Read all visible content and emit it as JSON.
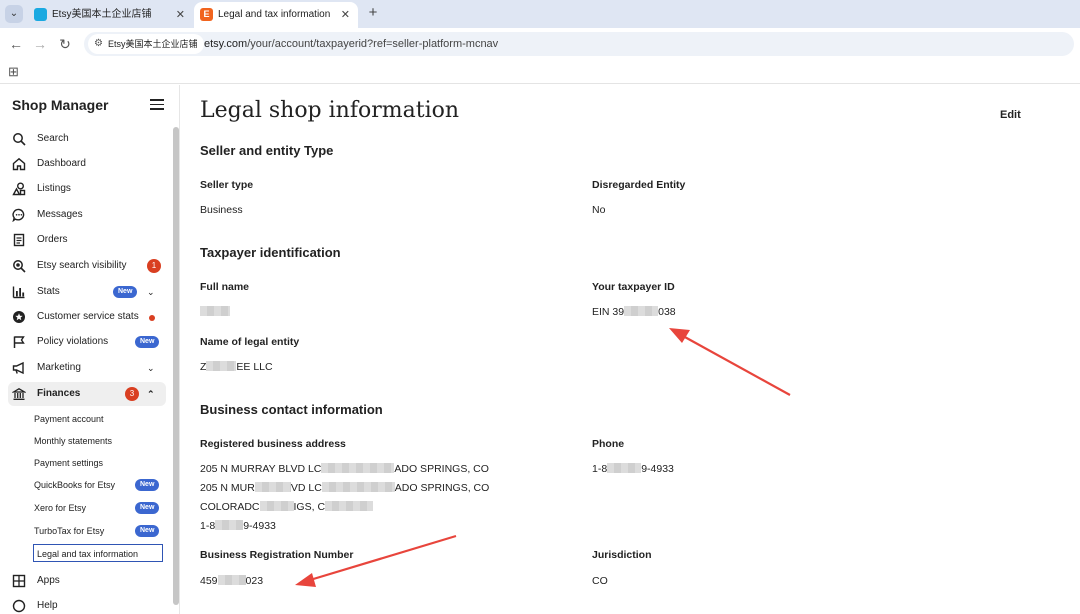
{
  "browser": {
    "tabs": [
      {
        "label": "Etsy美国本土企业店铺",
        "close": "✕"
      },
      {
        "label": "Legal and tax information",
        "close": "✕"
      }
    ],
    "tab_menu": "⌄",
    "new_tab": "+",
    "site_chip": "Etsy美国本土企业店铺",
    "url_host": "etsy.com",
    "url_path": "/your/account/taxpayerid?ref=seller-platform-mcnav",
    "nav": {
      "back": "←",
      "forward": "→",
      "reload": "↻"
    },
    "apps_glyph": "⊞"
  },
  "sidebar": {
    "title": "Shop Manager",
    "items": [
      {
        "label": "Search",
        "icon": "search-icon"
      },
      {
        "label": "Dashboard",
        "icon": "home-icon"
      },
      {
        "label": "Listings",
        "icon": "shapes-icon"
      },
      {
        "label": "Messages",
        "icon": "chat-icon"
      },
      {
        "label": "Orders",
        "icon": "receipt-icon"
      },
      {
        "label": "Etsy search visibility",
        "icon": "magnify-icon",
        "badge": "1"
      },
      {
        "label": "Stats",
        "icon": "bar-chart-icon",
        "tag": "New",
        "chevron": "⌄"
      },
      {
        "label": "Customer service stats",
        "icon": "star-badge-icon"
      },
      {
        "label": "Policy violations",
        "icon": "flag-icon",
        "tag": "New"
      },
      {
        "label": "Marketing",
        "icon": "megaphone-icon",
        "chevron": "⌄"
      },
      {
        "label": "Finances",
        "icon": "bank-icon",
        "badge": "3",
        "chevron": "⌃"
      }
    ],
    "sub_items": [
      {
        "label": "Payment account"
      },
      {
        "label": "Monthly statements"
      },
      {
        "label": "Payment settings"
      },
      {
        "label": "QuickBooks for Etsy",
        "tag": "New"
      },
      {
        "label": "Xero for Etsy",
        "tag": "New"
      },
      {
        "label": "TurboTax for Etsy",
        "tag": "New"
      },
      {
        "label": "Legal and tax information"
      }
    ],
    "apps": {
      "label": "Apps",
      "icon": "grid-icon"
    },
    "help": {
      "label": "Help"
    }
  },
  "main": {
    "title": "Legal shop information",
    "edit_label": "Edit",
    "seller_section": {
      "title": "Seller and entity Type",
      "seller_type_label": "Seller type",
      "seller_type_value": "Business",
      "disregarded_label": "Disregarded Entity",
      "disregarded_value": "No"
    },
    "taxpayer_section": {
      "title": "Taxpayer identification",
      "full_name_label": "Full name",
      "taxpayer_id_label": "Your taxpayer ID",
      "taxpayer_id_prefix": "EIN 39",
      "taxpayer_id_suffix": "038",
      "entity_label": "Name of legal entity",
      "entity_prefix": "Z",
      "entity_suffix": "EE LLC"
    },
    "contact_section": {
      "title": "Business contact information",
      "address_label": "Registered business address",
      "address_line1": {
        "a": "205 N MURRAY BLVD LC",
        "b": "ADO SPRINGS, CO"
      },
      "address_line2": {
        "a": "205 N MUR",
        "b": "VD LC",
        "c": "ADO SPRINGS, CO"
      },
      "address_line3": {
        "a": "COLORADC",
        "b": "IGS, C"
      },
      "address_line4": {
        "a": "1-8",
        "b": "9-4933"
      },
      "phone_label": "Phone",
      "phone": {
        "a": "1-8",
        "b": "9-4933"
      },
      "brn_label": "Business Registration Number",
      "brn": {
        "a": "459",
        "b": "023"
      },
      "jurisdiction_label": "Jurisdiction",
      "jurisdiction_value": "CO"
    }
  },
  "colors": {
    "etsy_orange": "#f1641e",
    "badge_red": "#d93f21",
    "new_blue": "#3b67d0",
    "arrow_red": "#e8453c"
  }
}
